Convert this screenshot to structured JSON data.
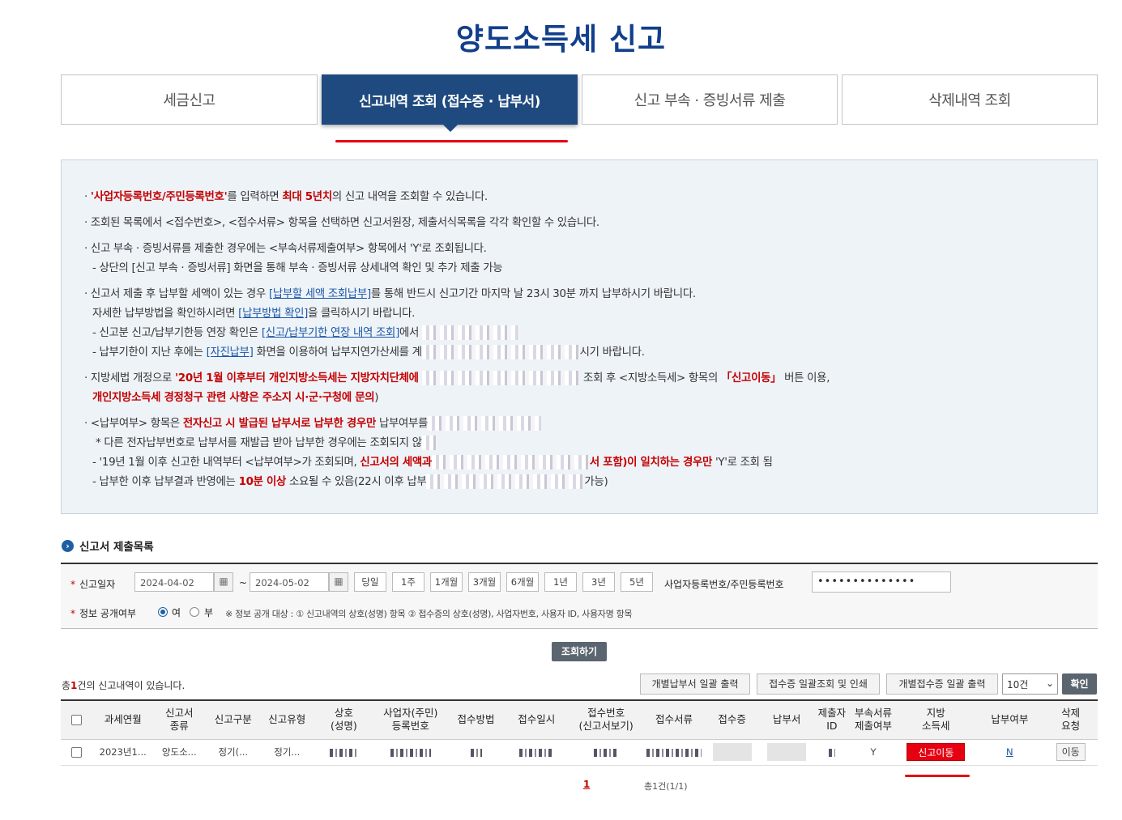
{
  "page": {
    "title": "양도소득세 신고"
  },
  "tabs": [
    {
      "label": "세금신고"
    },
    {
      "label": "신고내역 조회 (접수증 · 납부서)"
    },
    {
      "label": "신고 부속 · 증빙서류 제출"
    },
    {
      "label": "삭제내역 조회"
    }
  ],
  "notices": {
    "n1_red": "'사업자등록번호/주민등록번호'",
    "n1_a": "를 입력하면 ",
    "n1_red2": "최대 5년치",
    "n1_b": "의 신고 내역을 조회할 수 있습니다.",
    "n2": "조회된 목록에서 <접수번호>, <접수서류> 항목을 선택하면 신고서원장, 제출서식목록을 각각 확인할 수 있습니다.",
    "n3": "신고 부속 · 증빙서류를 제출한 경우에는 <부속서류제출여부> 항목에서 'Y'로 조회됩니다.",
    "n3_sub": "- 상단의 [신고 부속 · 증빙서류] 화면을 통해 부속 · 증빙서류 상세내역 확인 및 추가 제출 가능",
    "n4_a": "신고서 제출 후 납부할 세액이 있는 경우 ",
    "n4_link": "[납부할 세액 조회납부]",
    "n4_b": "를 통해 반드시 신고기간 마지막 날 23시 30분 까지 납부하시기 바랍니다.",
    "n4_c": "자세한 납부방법을 확인하시려면 ",
    "n4_link2": "[납부방법 확인]",
    "n4_d": "을 클릭하시기 바랍니다.",
    "n4_e": "- 신고분 신고/납부기한등 연장 확인은 ",
    "n4_link3": "[신고/납부기한 연장 내역 조회]",
    "n4_f": "에서",
    "n4_g": "- 납부기한이 지난 후에는 ",
    "n4_link4": "[자진납부]",
    "n4_h": " 화면을 이용하여 납부지연가산세를 계",
    "n4_i": "시기 바랍니다.",
    "n5_a": "지방세법 개정으로 ",
    "n5_red": "'20년 1월 이후부터 개인지방소득세는 지방자치단체에 ",
    "n5_b": "조회 후 <지방소득세> 항목의 ",
    "n5_red2": "「신고이동」",
    "n5_c": " 버튼 이용,",
    "n5_red3": "개인지방소득세 경정청구 관련 사항은 주소지 시·군·구청에 문의",
    "n5_d": ")",
    "n6_a": "<납부여부> 항목은 ",
    "n6_red": "전자신고 시 발급된 납부서로 납부한 경우만",
    "n6_b": " 납부여부를",
    "n6_sub1": "* 다른 전자납부번호로 납부서를 재발급 받아 납부한 경우에는 조회되지 않",
    "n6_sub2_a": "- '19년 1월 이후 신고한 내역부터 <납부여부>가 조회되며, ",
    "n6_sub2_red": "신고서의 세액과",
    "n6_sub2_red2": "서 포함)이 일치하는 경우만",
    "n6_sub2_b": " 'Y'로 조회 됨",
    "n6_sub3_a": "- 납부한 이후 납부결과 반영에는 ",
    "n6_sub3_red": "10분 이상",
    "n6_sub3_b": " 소요될 수 있음(22시 이후 납부",
    "n6_sub3_c": "가능)"
  },
  "section": {
    "title": "신고서 제출목록"
  },
  "search": {
    "date_label": "신고일자",
    "date_from": "2024-04-02",
    "date_to": "2024-05-02",
    "tilde": "~",
    "periods": [
      "당일",
      "1주",
      "1개월",
      "3개월",
      "6개월",
      "1년",
      "3년",
      "5년"
    ],
    "id_label": "사업자등록번호/주민등록번호",
    "id_value": "••••••••••••••",
    "public_label": "정보 공개여부",
    "public_yes": "여",
    "public_no": "부",
    "public_note": "※ 정보 공개 대상 : ① 신고내역의 상호(성명) 항목 ② 접수증의 상호(성명), 사업자번호, 사용자 ID, 사용자명 항목",
    "search_button": "조회하기"
  },
  "list": {
    "total_pre": "총",
    "total_count": "1",
    "total_post": "건의 신고내역이 있습니다.",
    "btn_print_payment": "개별납부서 일괄 출력",
    "btn_print_receipt_list": "접수증 일괄조회 및 인쇄",
    "btn_print_receipt": "개별접수증 일괄 출력",
    "page_size": "10건",
    "confirm": "확인"
  },
  "table": {
    "headers": [
      {
        "l1": "과세연월",
        "l2": ""
      },
      {
        "l1": "신고서",
        "l2": "종류"
      },
      {
        "l1": "신고구분",
        "l2": ""
      },
      {
        "l1": "신고유형",
        "l2": ""
      },
      {
        "l1": "상호",
        "l2": "(성명)"
      },
      {
        "l1": "사업자(주민)",
        "l2": "등록번호"
      },
      {
        "l1": "접수방법",
        "l2": ""
      },
      {
        "l1": "접수일시",
        "l2": ""
      },
      {
        "l1": "접수번호",
        "l2": "(신고서보기)"
      },
      {
        "l1": "접수서류",
        "l2": ""
      },
      {
        "l1": "접수증",
        "l2": ""
      },
      {
        "l1": "납부서",
        "l2": ""
      },
      {
        "l1": "제출자",
        "l2": "ID"
      },
      {
        "l1": "부속서류",
        "l2": "제출여부"
      },
      {
        "l1": "지방",
        "l2": "소득세"
      },
      {
        "l1": "납부여부",
        "l2": ""
      },
      {
        "l1": "삭제",
        "l2": "요청"
      }
    ],
    "row": {
      "period": "2023년1...",
      "form": "양도소...",
      "type": "정기(...",
      "kind": "정기...",
      "attach": "Y",
      "local_tax_button": "신고이동",
      "paid": "N",
      "delete_button": "이동"
    }
  },
  "pagination": {
    "current": "1",
    "summary": "총1건(1/1)"
  },
  "colors": {
    "brand": "#123f8b",
    "tab_active": "#1f4a7f",
    "accent_red": "#e60012",
    "info_bg": "#eef3f8"
  }
}
